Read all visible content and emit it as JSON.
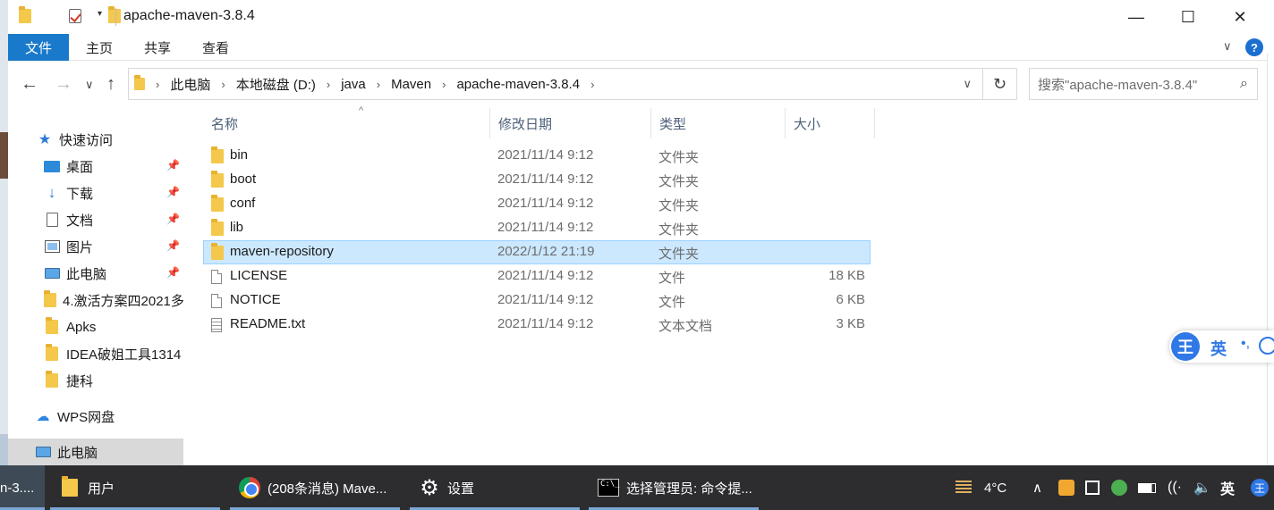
{
  "window": {
    "title": "apache-maven-3.8.4",
    "minimize": "—",
    "maximize": "☐",
    "close": "✕"
  },
  "ribbon": {
    "tabs": [
      "文件",
      "主页",
      "共享",
      "查看"
    ],
    "collapse": "∨",
    "help": "?"
  },
  "address": {
    "crumbs": [
      "此电脑",
      "本地磁盘 (D:)",
      "java",
      "Maven",
      "apache-maven-3.8.4"
    ],
    "separator": "›",
    "dropdown": "∨",
    "refresh": "↻"
  },
  "search": {
    "placeholder": "搜索\"apache-maven-3.8.4\"",
    "icon": "search-icon"
  },
  "nav_pane": {
    "items": [
      {
        "label": "快速访问",
        "icon": "star-icon",
        "pinned": false
      },
      {
        "label": "桌面",
        "icon": "desktop-icon",
        "pinned": true
      },
      {
        "label": "下载",
        "icon": "download-icon",
        "pinned": true
      },
      {
        "label": "文档",
        "icon": "document-icon",
        "pinned": true
      },
      {
        "label": "图片",
        "icon": "pictures-icon",
        "pinned": true
      },
      {
        "label": "此电脑",
        "icon": "pc-icon",
        "pinned": true
      },
      {
        "label": "4.激活方案四2021多",
        "icon": "folder-icon",
        "pinned": false
      },
      {
        "label": "Apks",
        "icon": "folder-icon",
        "pinned": false
      },
      {
        "label": "IDEA破姐工具1314",
        "icon": "folder-icon",
        "pinned": false
      },
      {
        "label": "捷科",
        "icon": "folder-icon",
        "pinned": false
      },
      {
        "label": "WPS网盘",
        "icon": "cloud-icon",
        "pinned": false
      },
      {
        "label": "此电脑",
        "icon": "pc-icon",
        "pinned": false,
        "selected": true
      }
    ]
  },
  "columns": {
    "name": "名称",
    "date": "修改日期",
    "type": "类型",
    "size": "大小",
    "sort_indicator": "^"
  },
  "files": [
    {
      "name": "bin",
      "date": "2021/11/14 9:12",
      "type": "文件夹",
      "size": "",
      "kind": "folder"
    },
    {
      "name": "boot",
      "date": "2021/11/14 9:12",
      "type": "文件夹",
      "size": "",
      "kind": "folder"
    },
    {
      "name": "conf",
      "date": "2021/11/14 9:12",
      "type": "文件夹",
      "size": "",
      "kind": "folder"
    },
    {
      "name": "lib",
      "date": "2021/11/14 9:12",
      "type": "文件夹",
      "size": "",
      "kind": "folder"
    },
    {
      "name": "maven-repository",
      "date": "2022/1/12 21:19",
      "type": "文件夹",
      "size": "",
      "kind": "folder",
      "selected": true
    },
    {
      "name": "LICENSE",
      "date": "2021/11/14 9:12",
      "type": "文件",
      "size": "18 KB",
      "kind": "file"
    },
    {
      "name": "NOTICE",
      "date": "2021/11/14 9:12",
      "type": "文件",
      "size": "6 KB",
      "kind": "file"
    },
    {
      "name": "README.txt",
      "date": "2021/11/14 9:12",
      "type": "文本文档",
      "size": "3 KB",
      "kind": "text"
    }
  ],
  "ime": {
    "logo": "王",
    "lang": "英",
    "punct": "•,"
  },
  "taskbar": {
    "items": [
      {
        "label": "n-3....",
        "icon": ""
      },
      {
        "label": "用户",
        "icon": "folder-icon"
      },
      {
        "label": "(208条消息) Mave...",
        "icon": "chrome-icon"
      },
      {
        "label": "设置",
        "icon": "gear-icon"
      },
      {
        "label": "选择管理员: 命令提...",
        "icon": "cmd-icon"
      }
    ],
    "weather": "4°C",
    "chevron": "∧",
    "ime_lang": "英",
    "ime_logo": "王"
  },
  "colors": {
    "accent": "#1979ca",
    "selection": "#cce8ff",
    "taskbar": "#2d2d30",
    "folder": "#f4c84b"
  }
}
